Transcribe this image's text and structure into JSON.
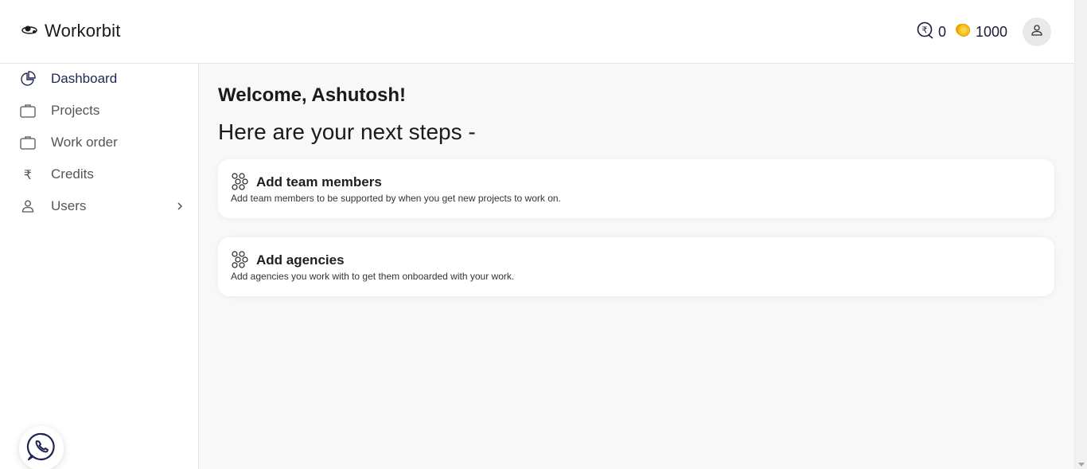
{
  "app": {
    "name": "Workorbit"
  },
  "header": {
    "rupee_credits": "0",
    "coins": "1000"
  },
  "sidebar": {
    "items": [
      {
        "label": "Dashboard",
        "icon": "pie-chart-icon",
        "active": true
      },
      {
        "label": "Projects",
        "icon": "briefcase-icon"
      },
      {
        "label": "Work order",
        "icon": "briefcase-icon"
      },
      {
        "label": "Credits",
        "icon": "rupee-icon"
      },
      {
        "label": "Users",
        "icon": "user-icon",
        "has_submenu": true
      }
    ]
  },
  "main": {
    "welcome": "Welcome, Ashutosh!",
    "subtitle": "Here are your next steps -",
    "cards": [
      {
        "title": "Add team members",
        "description": "Add team members to be supported by when you get new projects to work on."
      },
      {
        "title": "Add agencies",
        "description": "Add agencies you work with to get them onboarded with your work."
      }
    ]
  },
  "colors": {
    "accent": "#1e2550",
    "background": "#f8f8f8",
    "coin": "#f5b400"
  }
}
